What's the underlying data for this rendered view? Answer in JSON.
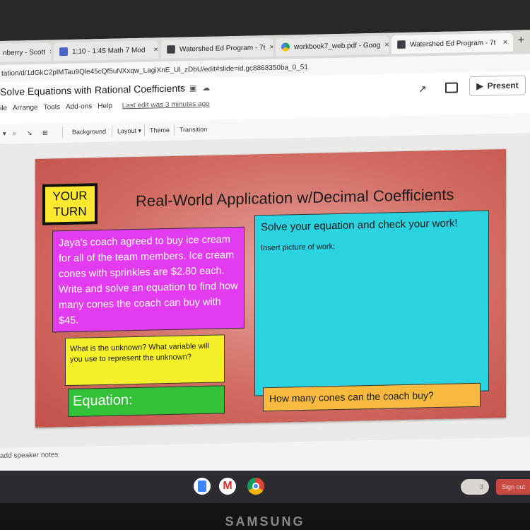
{
  "browser": {
    "tabs": [
      {
        "label": "nberry - Scott",
        "icon": "generic-icon"
      },
      {
        "label": "1:10 - 1:45 Math 7 Mod",
        "icon": "meet-icon"
      },
      {
        "label": "Watershed Ed Program - 7t",
        "icon": "slides-icon"
      },
      {
        "label": "workbook7_web.pdf - Goog",
        "icon": "drive-icon"
      },
      {
        "label": "Watershed Ed Program - 7t",
        "icon": "slides-icon"
      }
    ],
    "close_glyph": "×",
    "new_tab_glyph": "+",
    "url": "tation/d/1dGkC2plMTau9Qle45cQf5uNXxqw_LagiXnE_Ul_zDbU/edit#slide=id.gc8868350ba_0_51"
  },
  "docs": {
    "title": "Solve Equations with Rational Coefficients",
    "menus": [
      "ile",
      "Arrange",
      "Tools",
      "Add-ons",
      "Help"
    ],
    "last_edit": "Last edit was 3 minutes ago",
    "present_label": "Present"
  },
  "toolbar": {
    "background_label": "Background",
    "layout_label": "Layout ▾",
    "theme_label": "Theme",
    "transition_label": "Transition"
  },
  "slide": {
    "your_turn_line1": "YOUR",
    "your_turn_line2": "TURN",
    "title": "Real-World Application w/Decimal Coefficients",
    "problem": "Jaya's coach agreed to buy ice cream for all of the team members. Ice cream cones with sprinkles are $2.80 each. Write and solve an equation to find how many cones the coach can buy with $45.",
    "work_title": "Solve your equation and check your work!",
    "work_subtitle": "Insert picture of work:",
    "unknown_prompt": "What is the unknown? What variable will you use to represent the unknown?",
    "equation_label": "Equation:",
    "cones_prompt": "How many cones can the coach buy?"
  },
  "speaker_notes": "add speaker notes",
  "shelf": {
    "status_text": "3",
    "signout_label": "Sign out"
  },
  "device_brand": "SAMSUNG"
}
